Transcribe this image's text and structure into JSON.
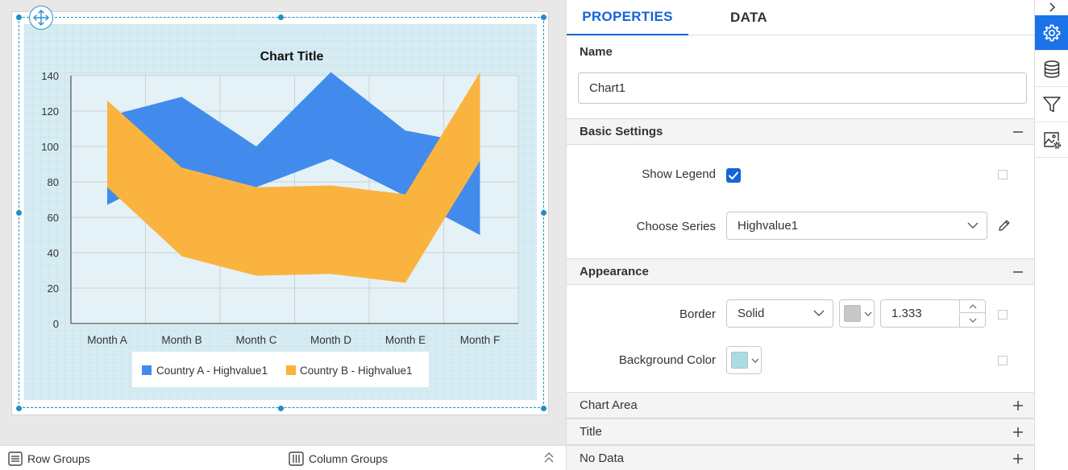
{
  "chart": {
    "title": "Chart Title",
    "legend": [
      "Country A - Highvalue1",
      "Country B - Highvalue1"
    ]
  },
  "chart_data": {
    "type": "area",
    "title": "Chart Title",
    "xlabel": "",
    "ylabel": "",
    "categories": [
      "Month A",
      "Month B",
      "Month C",
      "Month D",
      "Month E",
      "Month F"
    ],
    "ylim": [
      0,
      140
    ],
    "yticks": [
      0,
      20,
      40,
      60,
      80,
      100,
      120,
      140
    ],
    "grid": true,
    "legend_position": "bottom",
    "series": [
      {
        "name": "Country A - Highvalue1",
        "color": "#428bec",
        "high": [
          117,
          128,
          100,
          142,
          109,
          101
        ],
        "low": [
          67,
          88,
          77,
          93,
          72,
          50
        ]
      },
      {
        "name": "Country B - Highvalue1",
        "color": "#fbb33f",
        "high": [
          126,
          88,
          77,
          78,
          73,
          142
        ],
        "low": [
          77,
          38,
          27,
          28,
          23,
          92
        ]
      }
    ]
  },
  "bottom_bar": {
    "row_groups": "Row Groups",
    "column_groups": "Column Groups"
  },
  "panel": {
    "tabs": {
      "properties": "PROPERTIES",
      "data": "DATA"
    },
    "name_label": "Name",
    "name_value": "Chart1",
    "sections": {
      "basic": "Basic Settings",
      "appearance": "Appearance",
      "chart_area": "Chart Area",
      "title": "Title",
      "no_data": "No Data"
    },
    "show_legend_label": "Show Legend",
    "show_legend_checked": true,
    "choose_series_label": "Choose Series",
    "choose_series_value": "Highvalue1",
    "border_label": "Border",
    "border_style": "Solid",
    "border_color": "#c8c8c8",
    "border_width": "1.333",
    "background_color_label": "Background Color",
    "background_color": "#a8dde6"
  },
  "colors": {
    "accent": "#1565d8",
    "rail_active": "#1a73e8",
    "chart_bg": "#d6ecf2"
  },
  "rail_icons": [
    "chevron-right-icon",
    "gear-icon",
    "database-icon",
    "filter-icon",
    "image-settings-icon"
  ]
}
